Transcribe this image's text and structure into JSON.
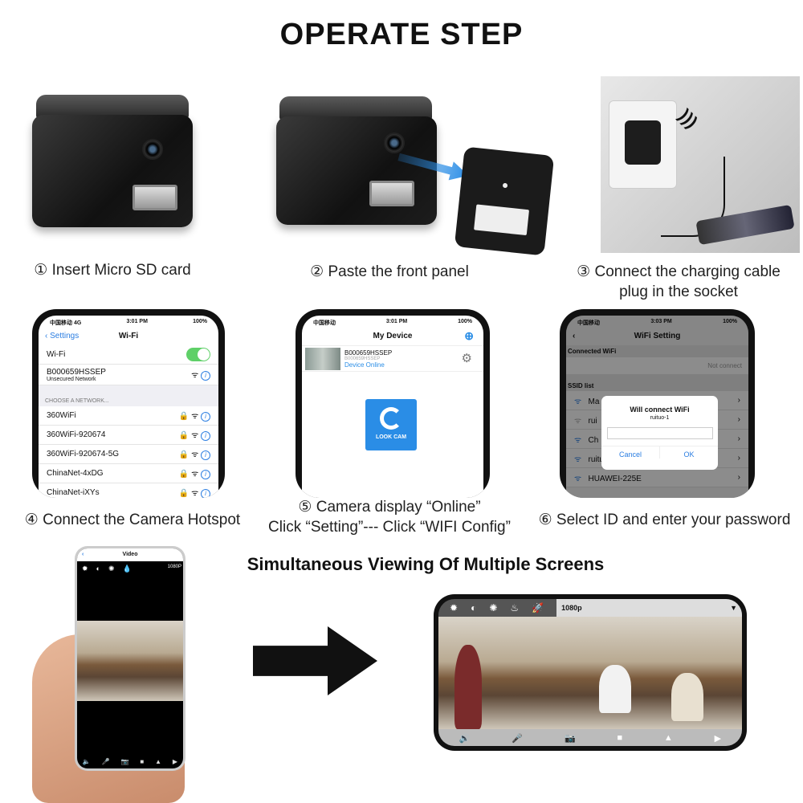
{
  "title": "OPERATE STEP",
  "steps": [
    {
      "label": "① Insert Micro SD card"
    },
    {
      "label": "② Paste the front panel"
    },
    {
      "label_line1": "③ Connect the charging cable",
      "label_line2": "plug in the socket"
    },
    {
      "label": "④ Connect the Camera Hotspot"
    },
    {
      "label_line1": "⑤ Camera display “Online”",
      "label_line2": "Click “Setting”--- Click “WIFI Config”"
    },
    {
      "label": "⑥ Select ID and enter your password"
    }
  ],
  "phone_wifi": {
    "carrier": "中国移动 4G",
    "time": "3:01 PM",
    "battery": "100%",
    "back": "Settings",
    "title": "Wi-Fi",
    "wifi_label": "Wi-Fi",
    "wifi_on": true,
    "connected": {
      "name": "B000659HSSEP",
      "sub": "Unsecured Network"
    },
    "section": "CHOOSE A NETWORK...",
    "networks": [
      "360WiFi",
      "360WiFi-920674",
      "360WiFi-920674-5G",
      "ChinaNet-4xDG",
      "ChinaNet-iXYs"
    ]
  },
  "phone_device": {
    "carrier": "中国移动",
    "time": "3:01 PM",
    "battery": "100%",
    "title": "My Device",
    "device_name": "B000659HSSEP",
    "device_id": "B000659HSSEP",
    "device_status": "Device Online",
    "app_name": "LOOK CAM",
    "accent": "#2a8de6"
  },
  "phone_wifi_setting": {
    "carrier": "中国移动",
    "time": "3:03 PM",
    "battery": "100%",
    "title": "WiFi Setting",
    "connected_header": "Connected WiFi",
    "connected_value": "Not connect",
    "ssid_header": "SSID list",
    "ssids": [
      "Ma",
      "rui",
      "Ch",
      "ruituo-1",
      "HUAWEI-225E"
    ],
    "dialog": {
      "title": "Will connect WiFi",
      "ssid": "ruituo-1",
      "password": "",
      "cancel": "Cancel",
      "ok": "OK"
    }
  },
  "multi_view": {
    "heading": "Simultaneous Viewing Of Multiple Screens",
    "portrait": {
      "title": "Video",
      "resolution": "1080P"
    },
    "landscape": {
      "resolution": "1080p"
    }
  }
}
